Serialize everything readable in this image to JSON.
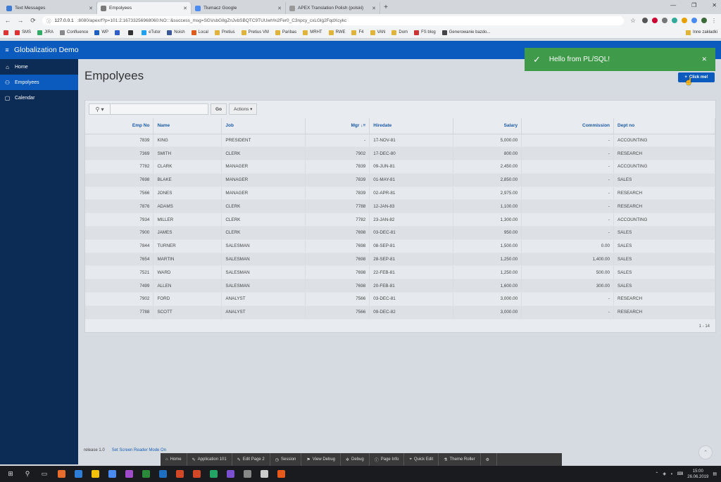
{
  "browser": {
    "tabs": [
      {
        "label": "Text Messages",
        "color": "#3c7bd6"
      },
      {
        "label": "Empolyees",
        "color": "#7a7a7a"
      },
      {
        "label": "Tłumacz Google",
        "color": "#4a8af4"
      },
      {
        "label": "APEX Translation Polish (polski)",
        "color": "#999999"
      }
    ],
    "url_host": "127.0.0.1",
    "url_rest": ":8080/apex/f?p=101:2:16733256968060:NO:::&success_msg=SGVsbG8gZnJvbSBQTC9TUUwh%2Fer0_C3npcy_cxLGlg2FqdXcykc",
    "bookmarks": [
      "SMS",
      "JIRA",
      "Confluence",
      "WP",
      "",
      "",
      "eTutor",
      "Noish",
      "Local",
      "Pretius",
      "Pretius VM",
      "Paribas",
      "MRHT",
      "RWE",
      "F4",
      "VAN",
      "Dom",
      "FS blog",
      "Generowanie bazdo..."
    ],
    "bookmarks_right": "Inne zakładki"
  },
  "app": {
    "title": "Globalization Demo",
    "nav": [
      {
        "label": "Home",
        "icon": "⌂"
      },
      {
        "label": "Empolyees",
        "icon": "⚇"
      },
      {
        "label": "Calendar",
        "icon": "▢"
      }
    ],
    "page_title": "Empolyees",
    "click_button": "Click me!",
    "toast": "Hello from PL/SQL!",
    "footer_release": "release 1.0",
    "footer_link": "Set Screen Reader Mode On"
  },
  "report": {
    "go_label": "Go",
    "actions_label": "Actions",
    "pagination": "1 - 14",
    "columns": [
      {
        "label": "Emp No",
        "align": "r"
      },
      {
        "label": "Name",
        "align": "l"
      },
      {
        "label": "Job",
        "align": "l"
      },
      {
        "label": "Mgr ↓≡",
        "align": "r"
      },
      {
        "label": "Hiredate",
        "align": "l"
      },
      {
        "label": "Salary",
        "align": "r"
      },
      {
        "label": "Commission",
        "align": "r"
      },
      {
        "label": "Dept no",
        "align": "l"
      }
    ],
    "rows": [
      [
        "7839",
        "KING",
        "PRESIDENT",
        "-",
        "17-NOV-81",
        "5,000.00",
        "-",
        "ACCOUNTING"
      ],
      [
        "7369",
        "SMITH",
        "CLERK",
        "7902",
        "17-DEC-80",
        "800.00",
        "-",
        "RESEARCH"
      ],
      [
        "7782",
        "CLARK",
        "MANAGER",
        "7839",
        "09-JUN-81",
        "2,450.00",
        "-",
        "ACCOUNTING"
      ],
      [
        "7698",
        "BLAKE",
        "MANAGER",
        "7839",
        "01-MAY-81",
        "2,850.00",
        "-",
        "SALES"
      ],
      [
        "7566",
        "JONES",
        "MANAGER",
        "7839",
        "02-APR-81",
        "2,975.00",
        "-",
        "RESEARCH"
      ],
      [
        "7876",
        "ADAMS",
        "CLERK",
        "7788",
        "12-JAN-83",
        "1,100.00",
        "-",
        "RESEARCH"
      ],
      [
        "7934",
        "MILLER",
        "CLERK",
        "7782",
        "23-JAN-82",
        "1,300.00",
        "-",
        "ACCOUNTING"
      ],
      [
        "7900",
        "JAMES",
        "CLERK",
        "7698",
        "03-DEC-81",
        "950.00",
        "-",
        "SALES"
      ],
      [
        "7844",
        "TURNER",
        "SALESMAN",
        "7698",
        "08-SEP-81",
        "1,500.00",
        "0.00",
        "SALES"
      ],
      [
        "7654",
        "MARTIN",
        "SALESMAN",
        "7698",
        "28-SEP-81",
        "1,250.00",
        "1,400.00",
        "SALES"
      ],
      [
        "7521",
        "WARD",
        "SALESMAN",
        "7698",
        "22-FEB-81",
        "1,250.00",
        "500.00",
        "SALES"
      ],
      [
        "7499",
        "ALLEN",
        "SALESMAN",
        "7698",
        "20-FEB-81",
        "1,600.00",
        "300.00",
        "SALES"
      ],
      [
        "7902",
        "FORD",
        "ANALYST",
        "7566",
        "03-DEC-81",
        "3,000.00",
        "-",
        "RESEARCH"
      ],
      [
        "7788",
        "SCOTT",
        "ANALYST",
        "7566",
        "09-DEC-82",
        "3,000.00",
        "-",
        "RESEARCH"
      ]
    ]
  },
  "devbar": [
    {
      "label": "Home",
      "icon": "⌂"
    },
    {
      "label": "Application 101",
      "icon": "✎"
    },
    {
      "label": "Edit Page 2",
      "icon": "✎"
    },
    {
      "label": "Session",
      "icon": "◷"
    },
    {
      "label": "View Debug",
      "icon": "⚑"
    },
    {
      "label": "Debug",
      "icon": "✲"
    },
    {
      "label": "Page Info",
      "icon": "ⓘ"
    },
    {
      "label": "Quick Edit",
      "icon": "⌖"
    },
    {
      "label": "Theme Roller",
      "icon": "⚗"
    },
    {
      "label": "",
      "icon": "⚙"
    }
  ],
  "taskbar": {
    "time": "15:00",
    "date": "26.06.2019",
    "apps": [
      "#e86c2c",
      "#2e7dd6",
      "#f2c200",
      "#4a8af4",
      "#a04cc8",
      "#2a8a3a",
      "#1f6fc0",
      "#d24726",
      "#d24726",
      "#22a565",
      "#7a4fd0",
      "#888888",
      "#cccccc",
      "#e85a1c"
    ]
  },
  "colors": {
    "header": "#0a5bbd",
    "sidebar": "#0c2c55",
    "toast": "#3f9b4a",
    "link": "#1c5aa6"
  }
}
